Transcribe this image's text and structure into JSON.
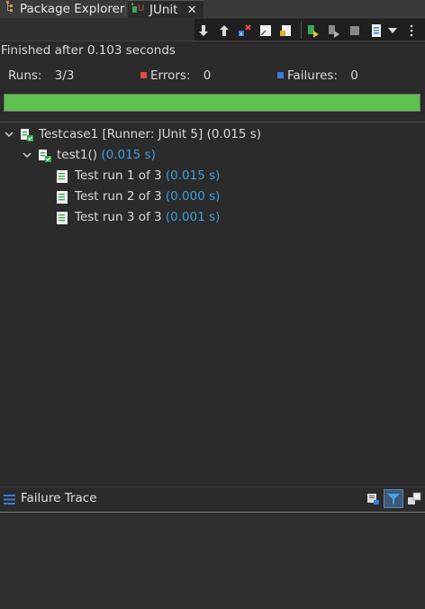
{
  "tabs": {
    "package_explorer": "Package Explorer",
    "junit": "JUnit"
  },
  "status": {
    "finished": "Finished after 0.103 seconds"
  },
  "counters": {
    "runs_label": "Runs:",
    "runs_value": "3/3",
    "errors_label": "Errors:",
    "errors_value": "0",
    "failures_label": "Failures:",
    "failures_value": "0"
  },
  "progress": {
    "fraction": 1.0,
    "color": "#5cc24d"
  },
  "tree": {
    "root": {
      "label": "Testcase1 [Runner: JUnit 5] (0.015 s)"
    },
    "method": {
      "label": "test1()",
      "time": "(0.015 s)"
    },
    "runs": [
      {
        "label": "Test run 1 of 3",
        "time": "(0.015 s)"
      },
      {
        "label": "Test run 2 of 3",
        "time": "(0.000 s)"
      },
      {
        "label": "Test run 3 of 3",
        "time": "(0.001 s)"
      }
    ]
  },
  "failure_trace": {
    "title": "Failure Trace"
  },
  "colors": {
    "background": "#2b2b2b",
    "time_text": "#3d9fd8",
    "progress_green": "#5cc24d"
  },
  "icons": {
    "toolbar": [
      "next-failure-icon",
      "previous-failure-icon",
      "show-failures-only-icon",
      "scroll-lock-icon",
      "show-skipped-only-icon",
      "rerun-test-icon",
      "rerun-failed-first-icon",
      "stop-icon",
      "test-run-history-icon",
      "view-menu-icon",
      "more-options-icon"
    ],
    "failure_trace": [
      "compare-results-icon",
      "filter-stack-trace-icon",
      "copy-trace-icon"
    ]
  }
}
